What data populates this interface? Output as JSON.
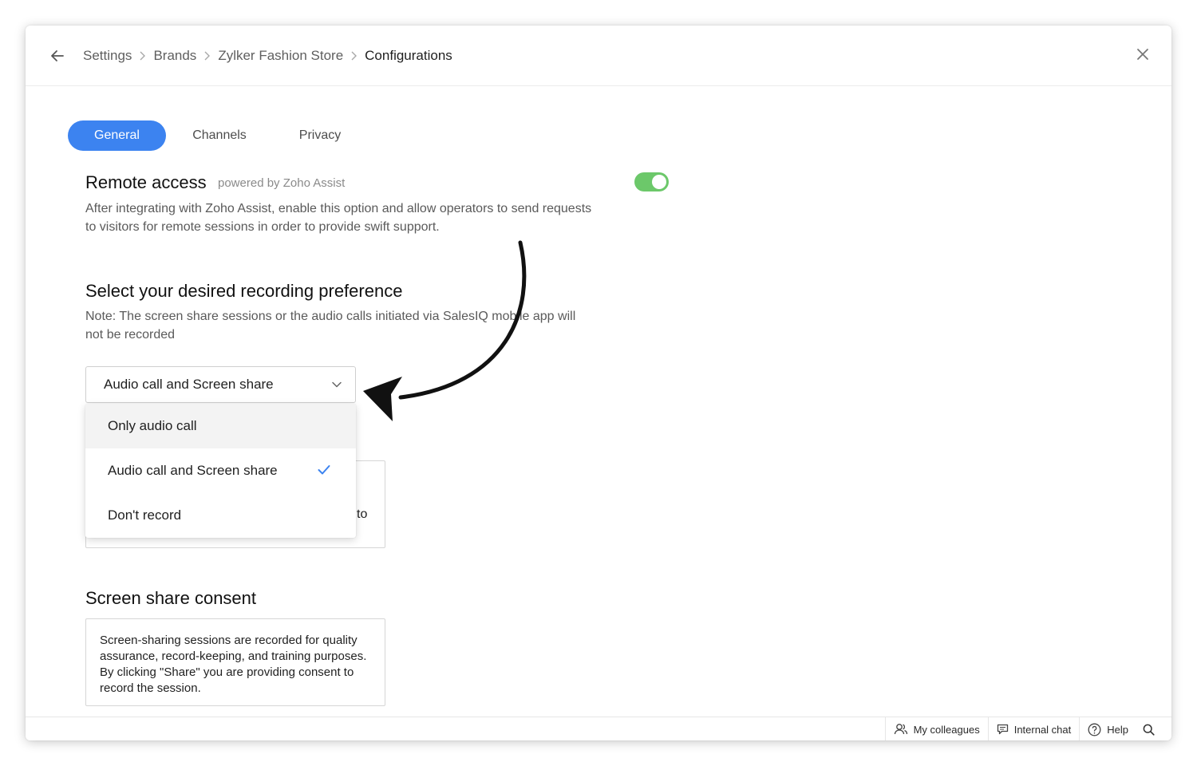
{
  "breadcrumb": {
    "items": [
      "Settings",
      "Brands",
      "Zylker Fashion Store"
    ],
    "current": "Configurations"
  },
  "tabs": [
    {
      "label": "General",
      "active": true
    },
    {
      "label": "Channels",
      "active": false
    },
    {
      "label": "Privacy",
      "active": false
    }
  ],
  "remote_access": {
    "title": "Remote access",
    "powered_by": "powered by Zoho Assist",
    "description": "After integrating with Zoho Assist, enable this option and allow operators to send requests to visitors for remote sessions in order to provide swift support.",
    "enabled": true
  },
  "recording": {
    "title": "Select your desired recording preference",
    "note": "Note: The screen share sessions or the audio calls initiated via SalesIQ mobile app will not be recorded",
    "selected": "Audio call and Screen share",
    "options": [
      "Only audio call",
      "Audio call and Screen share",
      "Don't record"
    ],
    "hidden_box_fragment": "to"
  },
  "consent": {
    "title": "Screen share consent",
    "text": "Screen-sharing sessions are recorded for quality assurance, record-keeping, and training purposes. By clicking \"Share\" you are providing consent to record the session."
  },
  "bottom_bar": {
    "colleagues": "My colleagues",
    "internal_chat": "Internal chat",
    "help": "Help"
  },
  "colors": {
    "accent": "#3c83f0",
    "toggle_on": "#6cc86a",
    "check": "#3c83f0"
  },
  "icons": [
    "back-arrow-icon",
    "chevron-right-icon",
    "close-icon",
    "chevron-down-icon",
    "check-icon",
    "users-icon",
    "chat-icon",
    "help-icon",
    "search-icon"
  ]
}
